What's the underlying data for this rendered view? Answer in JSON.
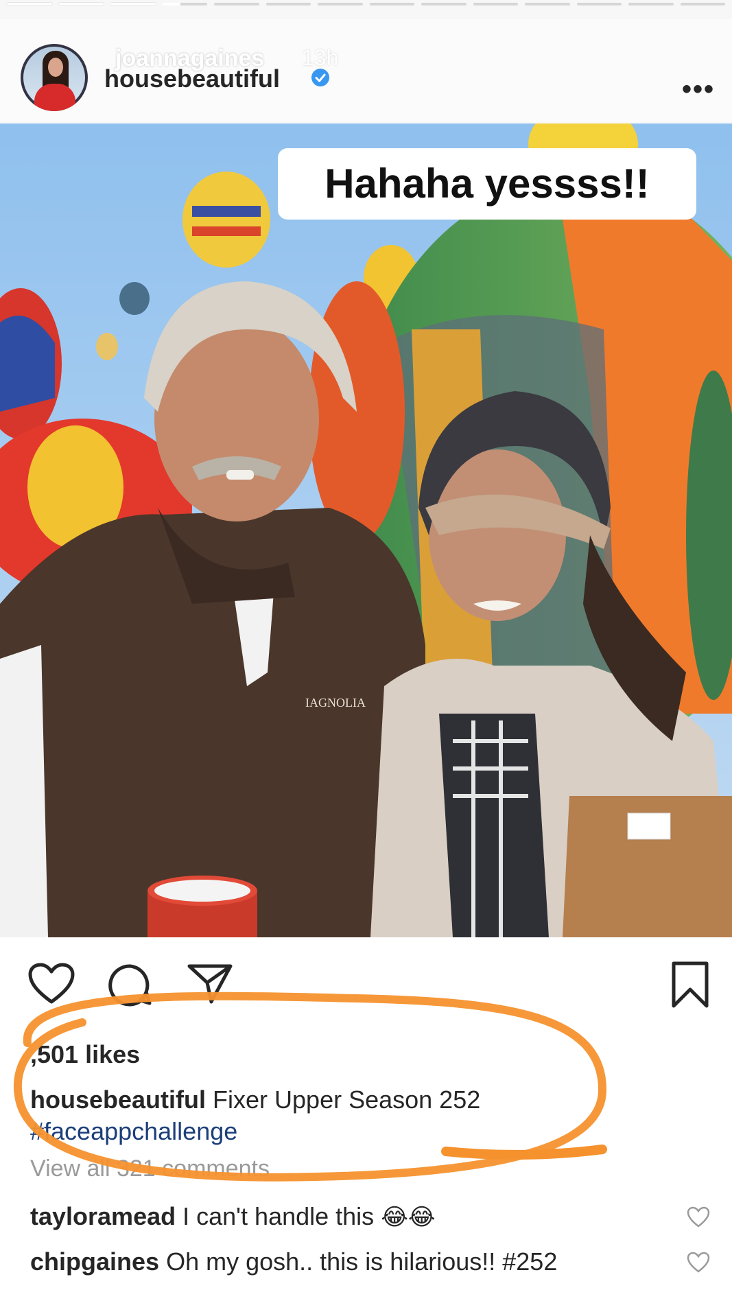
{
  "story": {
    "username": "joannagaines",
    "time": "13h",
    "progress_segments": 14
  },
  "post": {
    "username": "housebeautiful",
    "verified": true,
    "more_label": "•••",
    "overlay_text": "Hahaha yessss!!",
    "vest_logo_text": "IAGNOLIA",
    "likes": ",501 likes",
    "caption_user": "housebeautiful",
    "caption_text": "Fixer Upper Season 252",
    "hashtag": "#faceappchallenge",
    "view_all": "View all 321 comments",
    "comments": [
      {
        "user": "tayloramead",
        "text": "I can't handle this",
        "emoji": "😂😂"
      },
      {
        "user": "chipgaines",
        "text": "Oh my gosh.. this is hilarious!! #252"
      }
    ]
  },
  "colors": {
    "annotation": "#f5922e",
    "sky": "#7fb2e5",
    "link": "#1c3f7a",
    "verified": "#3897f0"
  }
}
